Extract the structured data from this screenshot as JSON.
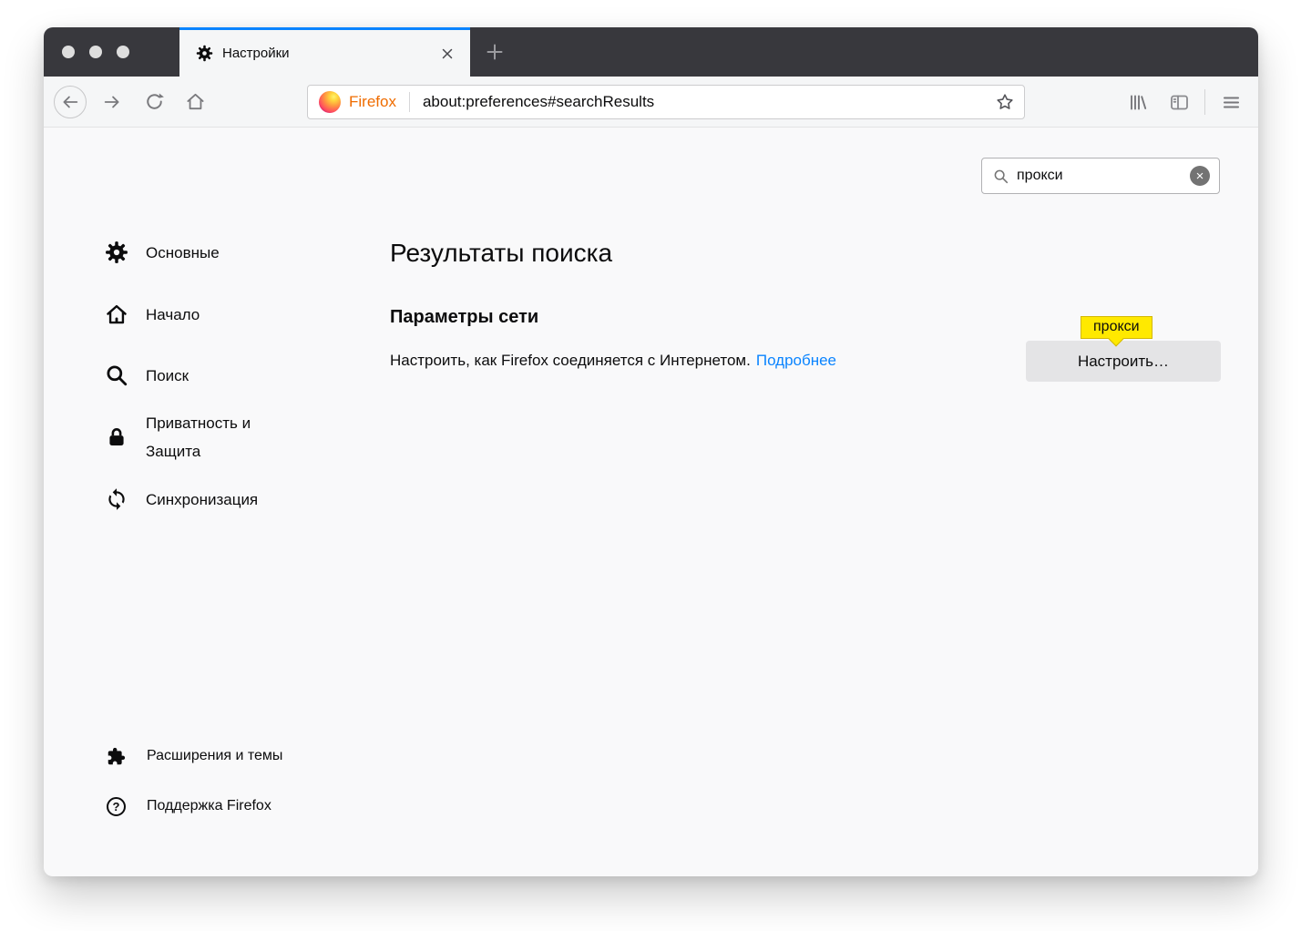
{
  "tab_bar": {
    "active_tab": {
      "title": "Настройки"
    }
  },
  "toolbar": {
    "brand_label": "Firefox",
    "url": "about:preferences#searchResults"
  },
  "content": {
    "search": {
      "value": "прокси"
    },
    "sidebar": {
      "items": [
        {
          "id": "general",
          "label": "Основные"
        },
        {
          "id": "home",
          "label": "Начало"
        },
        {
          "id": "search",
          "label": "Поиск"
        },
        {
          "id": "privacy",
          "label": "Приватность и Защита"
        },
        {
          "id": "sync",
          "label": "Синхронизация"
        }
      ],
      "footer": [
        {
          "id": "extensions",
          "label": "Расширения и темы"
        },
        {
          "id": "support",
          "label": "Поддержка Firefox",
          "icon_glyph": "?"
        }
      ]
    },
    "main": {
      "page_title": "Результаты поиска",
      "result": {
        "heading": "Параметры сети",
        "description": "Настроить, как Firefox соединяется с Интернетом.",
        "link_label": "Подробнее",
        "button_label": "Настроить…",
        "highlight_label": "прокси"
      }
    }
  },
  "colors": {
    "tab_strip_dark": "#38383d",
    "accent_blue": "#0a84ff",
    "link_blue": "#0a84ff",
    "highlight_yellow": "#ffe900",
    "toolbar_bg": "#f5f6f7",
    "content_bg": "#f9f9fa",
    "brand_orange": "#ef6c00",
    "button_gray": "#e4e4e6"
  },
  "icons": {
    "gear-icon": "⚙",
    "home-icon": "⌂",
    "search-icon": "🔍",
    "lock-icon": "🔒",
    "sync-icon": "⟳",
    "puzzle-icon": "puzzle",
    "help-icon": "?",
    "back-icon": "←",
    "forward-icon": "→",
    "reload-icon": "↻",
    "star-icon": "☆",
    "library-icon": "library",
    "sidebar-toggle-icon": "panel",
    "menu-icon": "≡",
    "close-icon": "×",
    "new-tab-icon": "+",
    "clear-icon": "⊗"
  }
}
